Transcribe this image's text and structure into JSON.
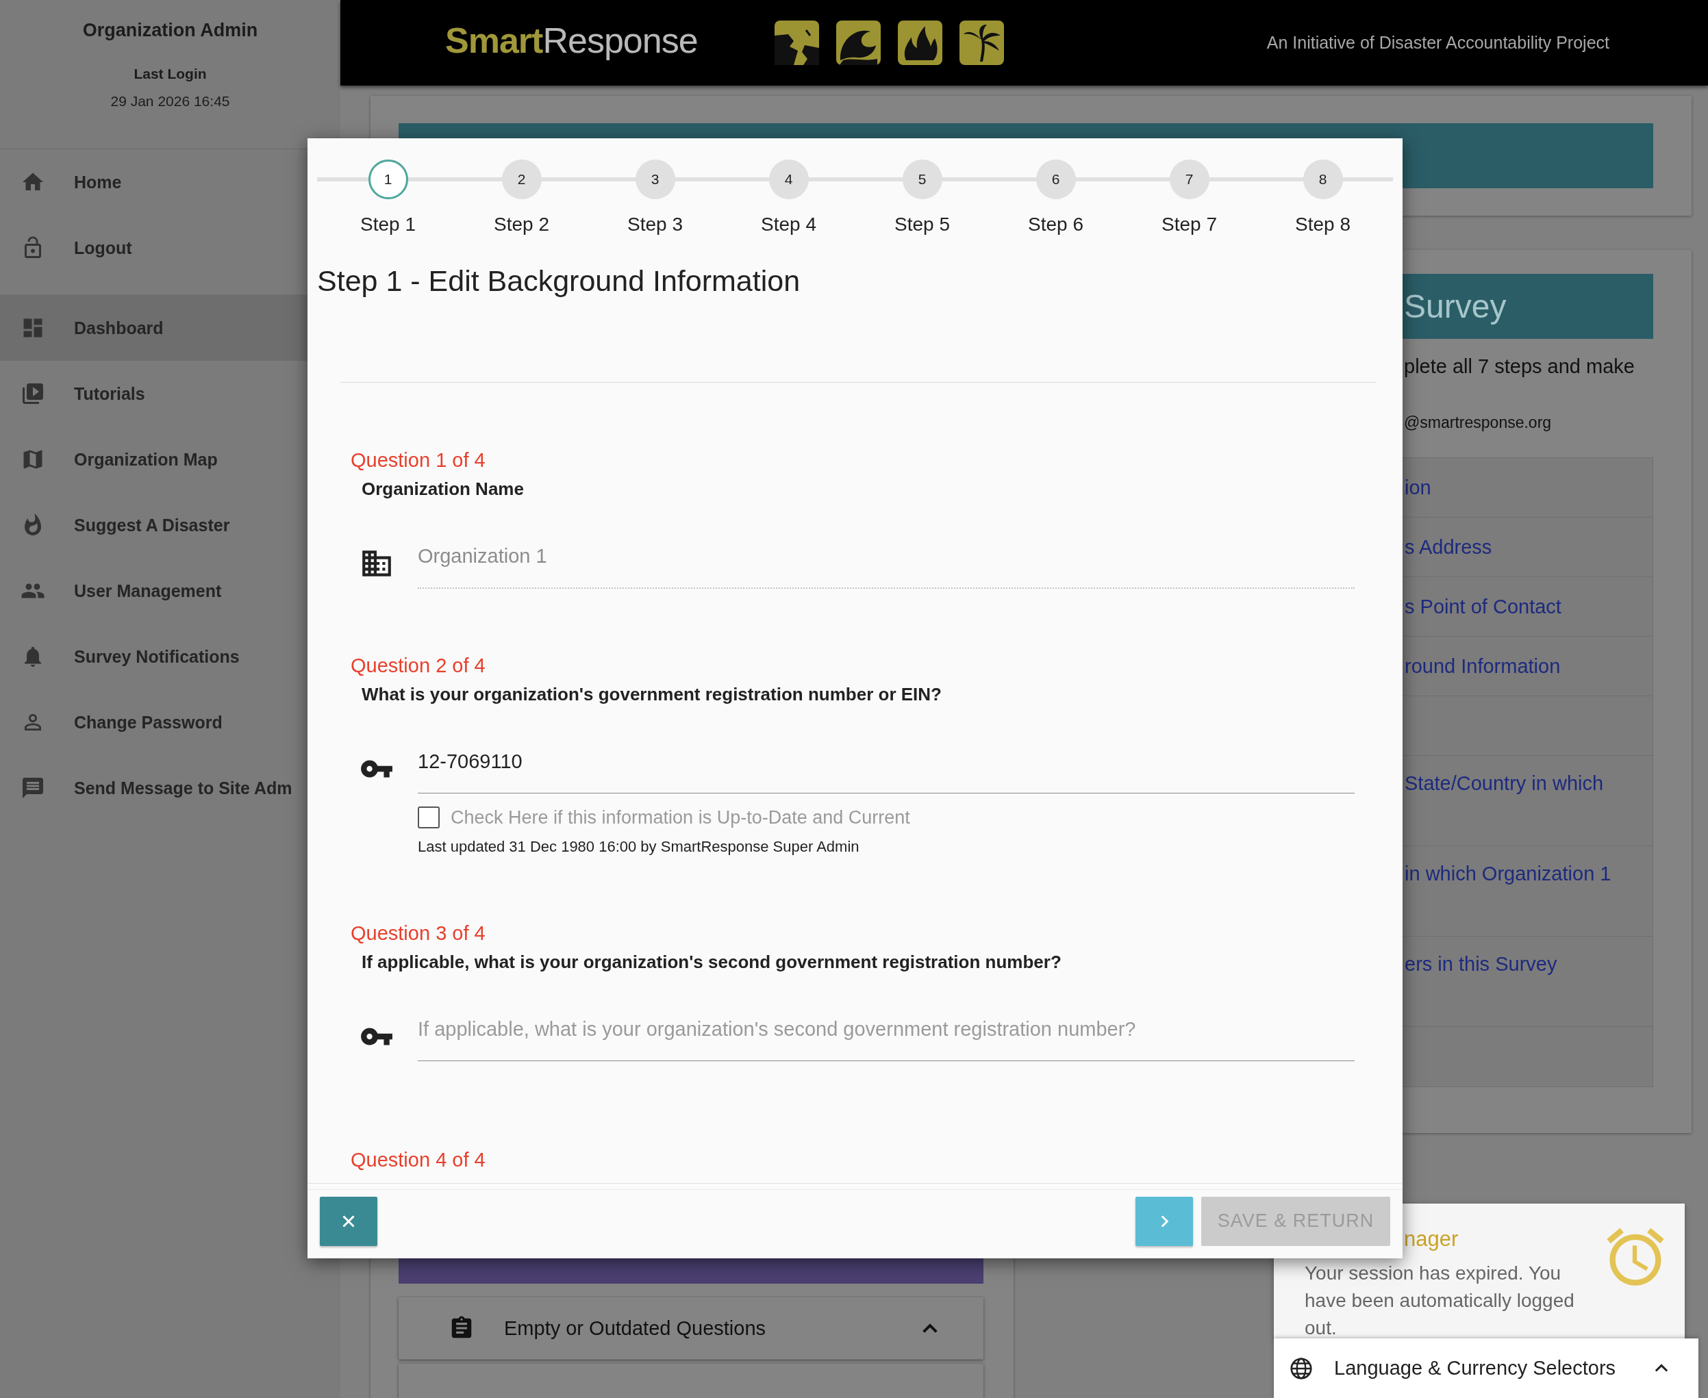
{
  "sidebar": {
    "role": "Organization Admin",
    "last_login_label": "Last Login",
    "last_login": "29 Jan 2026 16:45",
    "account_items": [
      {
        "label": "Home",
        "selected": false
      },
      {
        "label": "Logout",
        "selected": false
      }
    ],
    "nav_items": [
      {
        "label": "Dashboard",
        "selected": true
      },
      {
        "label": "Tutorials",
        "selected": false
      },
      {
        "label": "Organization Map",
        "selected": false
      },
      {
        "label": "Suggest A Disaster",
        "selected": false
      },
      {
        "label": "User Management",
        "selected": false
      },
      {
        "label": "Survey Notifications",
        "selected": false
      },
      {
        "label": "Change Password",
        "selected": false
      },
      {
        "label": "Send Message to Site Adm",
        "selected": false
      }
    ]
  },
  "header": {
    "logo_first": "Smart",
    "logo_second": "Response",
    "tagline": "An Initiative of Disaster Accountability Project"
  },
  "background": {
    "survey_title": "Survey",
    "intro": "plete all 7 steps and make",
    "email": "@smartresponse.org",
    "survey_rows": [
      {
        "text": "ion",
        "tall": false
      },
      {
        "text": "s Address",
        "tall": false
      },
      {
        "text": "s Point of Contact",
        "tall": false
      },
      {
        "text": "round Information",
        "tall": false
      },
      {
        "tall": false
      },
      {
        "text": "State/Country in which",
        "tall": true
      },
      {
        "text": "in which Organization 1",
        "tall": true
      },
      {
        "text": "ers in this Survey",
        "tall": true
      },
      {
        "tall": false
      }
    ],
    "accordion": {
      "title": "Empty or Outdated Questions",
      "expanded": true
    }
  },
  "modal": {
    "steps": [
      {
        "number": "1",
        "label": "Step 1",
        "selected": true
      },
      {
        "number": "2",
        "label": "Step 2",
        "selected": false
      },
      {
        "number": "3",
        "label": "Step 3",
        "selected": false
      },
      {
        "number": "4",
        "label": "Step 4",
        "selected": false
      },
      {
        "number": "5",
        "label": "Step 5",
        "selected": false
      },
      {
        "number": "6",
        "label": "Step 6",
        "selected": false
      },
      {
        "number": "7",
        "label": "Step 7",
        "selected": false
      },
      {
        "number": "8",
        "label": "Step 8",
        "selected": false
      }
    ],
    "title": "Step 1 - Edit Background Information",
    "questions": [
      {
        "kind": "name",
        "counter": "Question 1 of 4",
        "prompt": "Organization Name",
        "field": {
          "value": "Organization 1",
          "disabled": true
        }
      },
      {
        "kind": "registration",
        "counter": "Question 2 of 4",
        "prompt": "What is your organization's government registration number or EIN?",
        "field": {
          "value": "12-7069110",
          "disabled": false
        },
        "confirm": {
          "label": "Check Here if this information is Up-to-Date and Current",
          "checked": false
        },
        "last_updated": "Last updated 31 Dec 1980 16:00 by SmartResponse Super Admin"
      },
      {
        "kind": "registration",
        "counter": "Question 3 of 4",
        "prompt": "If applicable, what is your organization's second government registration number?",
        "field": {
          "placeholder": "If applicable, what is your organization's second government registration number?",
          "disabled": false
        }
      },
      {
        "kind": "heading",
        "counter": "Question 4 of 4"
      }
    ],
    "footer": {
      "save_label": "SAVE & RETURN",
      "save_disabled": true
    }
  },
  "toast": {
    "title": "nager",
    "message": "Your session has expired. You have been automatically logged out."
  },
  "language_bar": {
    "label": "Language & Currency Selectors"
  }
}
